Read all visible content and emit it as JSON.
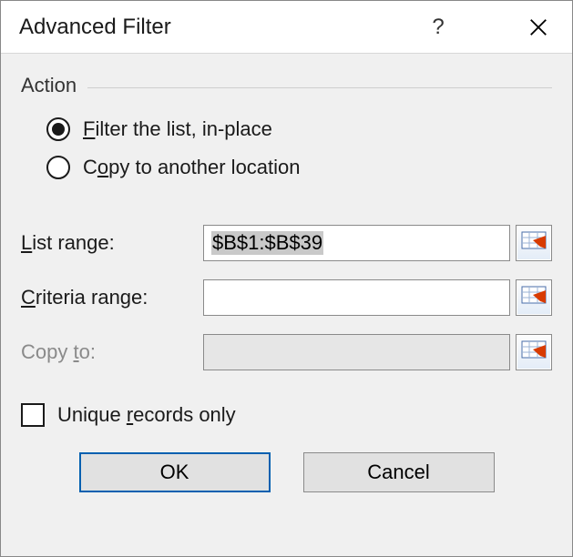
{
  "dialog": {
    "title": "Advanced Filter"
  },
  "action": {
    "group_label": "Action",
    "options": [
      {
        "label_pre": "",
        "label_u": "F",
        "label_post": "ilter the list, in-place",
        "checked": true
      },
      {
        "label_pre": "C",
        "label_u": "o",
        "label_post": "py to another location",
        "checked": false
      }
    ]
  },
  "fields": {
    "list_range": {
      "label_u": "L",
      "label_post": "ist range:",
      "value": "$B$1:$B$39",
      "disabled": false,
      "highlighted": true
    },
    "criteria_range": {
      "label_u": "C",
      "label_post": "riteria range:",
      "value": "",
      "disabled": false,
      "highlighted": false
    },
    "copy_to": {
      "label_pre": "Copy ",
      "label_u": "t",
      "label_post": "o:",
      "value": "",
      "disabled": true,
      "highlighted": false
    }
  },
  "unique": {
    "label_pre": "Unique ",
    "label_u": "r",
    "label_post": "ecords only",
    "checked": false
  },
  "buttons": {
    "ok": "OK",
    "cancel": "Cancel"
  }
}
